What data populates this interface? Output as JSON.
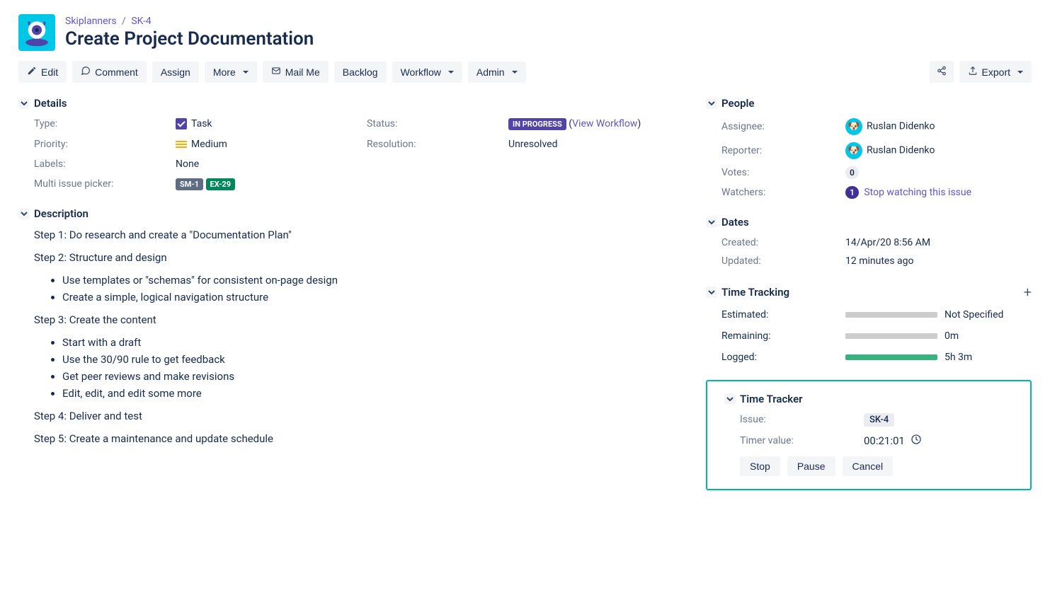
{
  "breadcrumb": {
    "project": "Skiplanners",
    "key": "SK-4",
    "sep": "/"
  },
  "title": "Create Project Documentation",
  "toolbar": {
    "edit": "Edit",
    "comment": "Comment",
    "assign": "Assign",
    "more": "More",
    "mail": "Mail Me",
    "backlog": "Backlog",
    "workflow": "Workflow",
    "admin": "Admin",
    "export": "Export"
  },
  "sections": {
    "details": "Details",
    "description": "Description",
    "people": "People",
    "dates": "Dates",
    "timetracking": "Time Tracking",
    "timetracker": "Time Tracker"
  },
  "details": {
    "type_l": "Type:",
    "type_v": "Task",
    "priority_l": "Priority:",
    "priority_v": "Medium",
    "labels_l": "Labels:",
    "labels_v": "None",
    "multi_l": "Multi issue picker:",
    "multi_v1": "SM-1",
    "multi_v2": "EX-29",
    "status_l": "Status:",
    "status_v": "IN PROGRESS",
    "status_link": "View Workflow",
    "resolution_l": "Resolution:",
    "resolution_v": "Unresolved"
  },
  "description": {
    "s1": "Step 1: Do research and create a \"Documentation Plan\"",
    "s2": "Step 2: Structure and design",
    "s2a": "Use templates or \"schemas\" for consistent on-page design",
    "s2b": "Create a simple, logical navigation structure",
    "s3": "Step 3: Create the content",
    "s3a": "Start with a draft",
    "s3b": "Use the 30/90 rule to get feedback",
    "s3c": "Get peer reviews and make revisions",
    "s3d": "Edit, edit, and edit some more",
    "s4": "Step 4: Deliver and test",
    "s5": "Step 5: Create a maintenance and update schedule"
  },
  "people": {
    "assignee_l": "Assignee:",
    "assignee_v": "Ruslan Didenko",
    "reporter_l": "Reporter:",
    "reporter_v": "Ruslan Didenko",
    "votes_l": "Votes:",
    "votes_v": "0",
    "watchers_l": "Watchers:",
    "watchers_count": "1",
    "watchers_action": "Stop watching this issue"
  },
  "dates": {
    "created_l": "Created:",
    "created_v": "14/Apr/20 8:56 AM",
    "updated_l": "Updated:",
    "updated_v": "12 minutes ago"
  },
  "timetracking": {
    "est_l": "Estimated:",
    "est_v": "Not Specified",
    "rem_l": "Remaining:",
    "rem_v": "0m",
    "log_l": "Logged:",
    "log_v": "5h 3m"
  },
  "tracker": {
    "issue_l": "Issue:",
    "issue_v": "SK-4",
    "timer_l": "Timer value:",
    "timer_v": "00:21:01",
    "stop": "Stop",
    "pause": "Pause",
    "cancel": "Cancel"
  }
}
